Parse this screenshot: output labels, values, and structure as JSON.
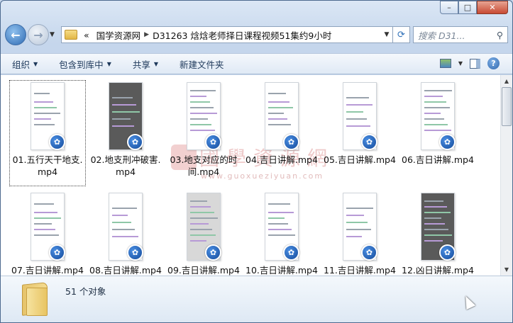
{
  "window": {
    "minimize_label": "–",
    "maximize_label": "□",
    "close_label": "✕"
  },
  "nav": {
    "back_glyph": "←",
    "forward_glyph": "→",
    "history_glyph": "▼"
  },
  "address": {
    "overflow": "«",
    "segments": [
      "国学资源网",
      "D31263 焓焓老师择日课程视频51集约9小时"
    ],
    "separator": "▶"
  },
  "search": {
    "placeholder": "搜索 D31..."
  },
  "toolbar": {
    "organize": "组织",
    "include_library": "包含到库中",
    "share": "共享",
    "new_folder": "新建文件夹"
  },
  "watermark": {
    "text": "國學資源網",
    "url": "www.guoxueziyuan.com"
  },
  "files": [
    {
      "label": "01.五行天干地支.\nmp4",
      "style": "white",
      "selected": true
    },
    {
      "label": "02.地支刑冲破害.\nmp4",
      "style": "dark",
      "selected": false
    },
    {
      "label": "03.地支对应的时\n间.mp4",
      "style": "white",
      "selected": false
    },
    {
      "label": "04.吉日讲解.mp4",
      "style": "white",
      "selected": false
    },
    {
      "label": "05.吉日讲解.mp4",
      "style": "white",
      "selected": false
    },
    {
      "label": "06.吉日讲解.mp4",
      "style": "white",
      "selected": false
    },
    {
      "label": "07.吉日讲解.mp4",
      "style": "white",
      "selected": false
    },
    {
      "label": "08.吉日讲解.mp4",
      "style": "white",
      "selected": false
    },
    {
      "label": "09.吉日讲解.mp4",
      "style": "gray",
      "selected": false
    },
    {
      "label": "10.吉日讲解.mp4",
      "style": "white",
      "selected": false
    },
    {
      "label": "11.吉日讲解.mp4",
      "style": "white",
      "selected": false
    },
    {
      "label": "12.凶日讲解.mp4",
      "style": "dark",
      "selected": false
    }
  ],
  "status": {
    "count": "51 个对象"
  }
}
